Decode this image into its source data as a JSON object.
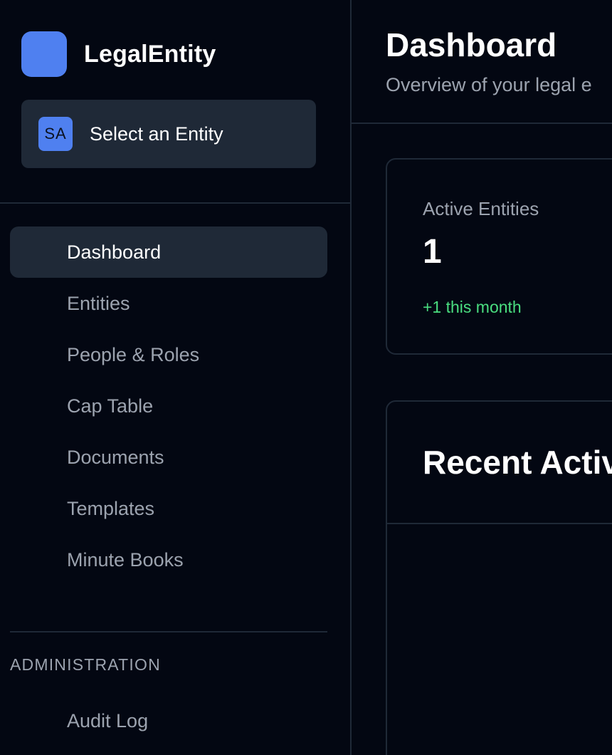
{
  "sidebar": {
    "brand": {
      "name": "LegalEntity",
      "logo_color": "#4f80f0"
    },
    "entity_selector": {
      "avatar_initials": "SA",
      "label": "Select an Entity"
    },
    "nav_items": [
      {
        "label": "Dashboard",
        "active": true
      },
      {
        "label": "Entities",
        "active": false
      },
      {
        "label": "People & Roles",
        "active": false
      },
      {
        "label": "Cap Table",
        "active": false
      },
      {
        "label": "Documents",
        "active": false
      },
      {
        "label": "Templates",
        "active": false
      },
      {
        "label": "Minute Books",
        "active": false
      }
    ],
    "admin_section": {
      "label": "ADMINISTRATION",
      "items": [
        {
          "label": "Audit Log"
        }
      ]
    }
  },
  "header": {
    "title": "Dashboard",
    "subtitle": "Overview of your legal e"
  },
  "stats": {
    "active_entities": {
      "label": "Active Entities",
      "value": "1",
      "change": "+1 this month"
    }
  },
  "activity": {
    "title": "Recent Activ"
  },
  "colors": {
    "background": "#030712",
    "surface": "#1f2937",
    "accent": "#4f80f0",
    "muted_text": "#9ca3af",
    "positive": "#4ade80"
  }
}
